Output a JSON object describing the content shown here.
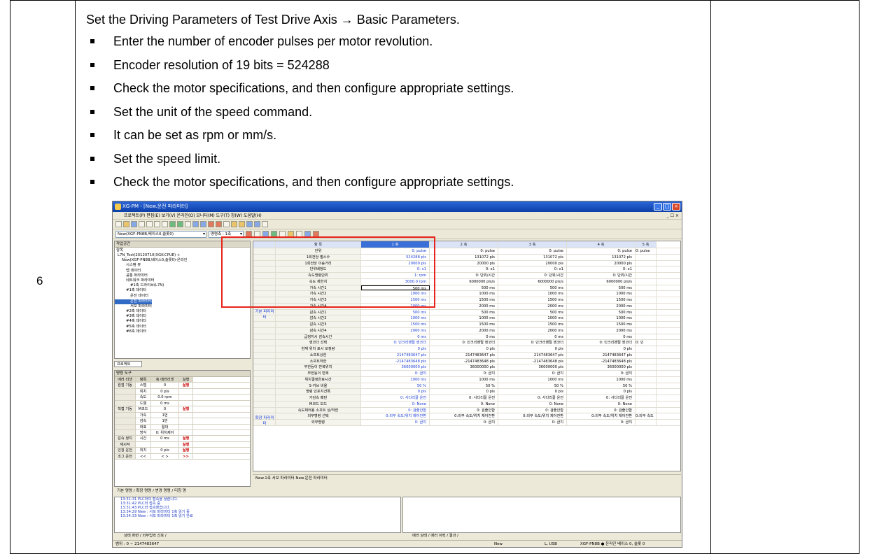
{
  "step": {
    "number": "6"
  },
  "instructions": {
    "intro": "Set the Driving Parameters of Test Drive Axis → Basic Parameters.",
    "bullets": [
      "Enter the number of encoder pulses per motor revolution.",
      "Encoder resolution of 19 bits = 524288",
      "Check the motor specifications, and then configure appropriate settings.",
      "Set the unit of the speed command.",
      "It can be set as rpm or mm/s.",
      "Set the speed limit.",
      "Check the motor specifications, and then configure appropriate settings."
    ]
  },
  "app": {
    "title": "XG-PM - [New.운전 파라미터]",
    "menu": "프로젝트(P)  편집(E)  보기(V)  온라인(O)  모니터(M)  도구(T)  창(W)  도움말(H)",
    "menu_right": "_ ☐ ×",
    "device_combo": "New(XGF-PN8B,베이스0,슬롯0)",
    "axis_combo": "명령축 : 1축",
    "workspace": {
      "title": "작업공간",
      "header": "항목",
      "tree": [
        "L7N_Test(20120710(XGK-CPUE) +",
        "New(XGF-PN8B,베이스0,슬롯0)-온라인",
        "시스템 뷰",
        "맵 데이터",
        "공통 파라미터",
        "네트워크 파라미터",
        "#1축 드라이브(L7N)",
        "#1축 데이터",
        "운전 데이터",
        "운전 파라미터",
        "서보 파라미터",
        "#2축 데이터",
        "#3축 데이터",
        "#4축 데이터",
        "#5축 데이터",
        "#6축 데이터"
      ],
      "selected_index": 9,
      "project_tab": "프로젝트"
    },
    "monitor": {
      "title": "명령 도구",
      "header": [
        "에러 리셋",
        "항목",
        "축 에러리셋",
        "실행"
      ],
      "rows": [
        [
          "원점 기동",
          "스텝",
          "0",
          "실행"
        ],
        [
          "",
          "위치",
          "0 pls",
          ""
        ],
        [
          "",
          "속도",
          "0.0 rpm",
          ""
        ],
        [
          "",
          "드웰",
          "0 ms",
          ""
        ],
        [
          "직접 기동",
          "M코드",
          "0",
          "실행"
        ],
        [
          "",
          "가속",
          "1번",
          ""
        ],
        [
          "",
          "감속",
          "1번",
          ""
        ],
        [
          "",
          "좌표",
          "절대",
          ""
        ],
        [
          "",
          "방식",
          "0: 위치제어",
          ""
        ],
        [
          "감속 정지",
          "시간",
          "0 ms",
          "실행"
        ],
        [
          "재시작",
          "",
          "",
          "실행"
        ],
        [
          "인칭 운전",
          "위치",
          "0 pls",
          "실행"
        ],
        [
          "조그 운전",
          "<<",
          "<  >",
          ">>"
        ]
      ],
      "tabs": "기본 명령 / 확장 명령 / 변경 명령 / 티칭 명"
    },
    "grid": {
      "header": [
        "항 목",
        "1 축",
        "2 축",
        "3 축",
        "4 축",
        "5 축"
      ],
      "group_basic": "기본 파라미터",
      "group_ext": "확장 파라미터",
      "rows": [
        [
          "단위",
          "0: pulse",
          "0: pulse",
          "0: pulse",
          "0: pulse"
        ],
        [
          "1회전당 펄스수",
          "524288 pls",
          "131072 pls",
          "131072 pls",
          "131072 pls"
        ],
        [
          "1회전당 이송거리",
          "20000 pls",
          "20000 pls",
          "20000 pls",
          "20000 pls"
        ],
        [
          "단위배정도",
          "0: x1",
          "0: x1",
          "0: x1",
          "0: x1"
        ],
        [
          "속도명령단위",
          "1: rpm",
          "0: 단위/시간",
          "0: 단위/시간",
          "0: 단위/시간"
        ],
        [
          "속도 제한치",
          "3000.0 rpm",
          "6000000 pls/s",
          "6000000 pls/s",
          "6000000 pls/s"
        ],
        [
          "가속 시간1",
          "500 ms",
          "500 ms",
          "500 ms",
          "500 ms"
        ],
        [
          "가속 시간2",
          "1000 ms",
          "1000 ms",
          "1000 ms",
          "1000 ms"
        ],
        [
          "가속 시간3",
          "1500 ms",
          "1500 ms",
          "1500 ms",
          "1500 ms"
        ],
        [
          "가속 시간4",
          "2000 ms",
          "2000 ms",
          "2000 ms",
          "2000 ms"
        ],
        [
          "감속 시간1",
          "500 ms",
          "500 ms",
          "500 ms",
          "500 ms"
        ],
        [
          "감속 시간2",
          "1000 ms",
          "1000 ms",
          "1000 ms",
          "1000 ms"
        ],
        [
          "감속 시간3",
          "1500 ms",
          "1500 ms",
          "1500 ms",
          "1500 ms"
        ],
        [
          "감속 시간4",
          "2000 ms",
          "2000 ms",
          "2000 ms",
          "2000 ms"
        ],
        [
          "급정지시 감속시간",
          "0 ms",
          "0 ms",
          "0 ms",
          "0 ms"
        ],
        [
          "엔코더 선택",
          "0: 인크리멘탈 엔코더",
          "0: 인크리멘탈 엔코더",
          "0: 인크리멘탈 엔코더",
          "0: 인크리멘탈 엔코더"
        ],
        [
          "현재 위치 표시 보정량",
          "0 pls",
          "0 pls",
          "0 pls",
          "0 pls"
        ],
        [
          "소프트상한",
          "2147483647 pls",
          "2147483647 pls",
          "2147483647 pls",
          "2147483647 pls"
        ],
        [
          "소프트하한",
          "-2147483648 pls",
          "-2147483648 pls",
          "-2147483648 pls",
          "-2147483648 pls"
        ],
        [
          "무한등이 반복위치",
          "36000000 pls",
          "36000000 pls",
          "36000000 pls",
          "36000000 pls"
        ],
        [
          "무한등이 반복",
          "0: 금지",
          "0: 금지",
          "0: 금지",
          "0: 금지"
        ],
        [
          "위치결정완료시간",
          "1000 ms",
          "1000 ms",
          "1000 ms",
          "1000 ms"
        ],
        [
          "S-커브 비율",
          "50 %",
          "50 %",
          "50 %",
          "50 %"
        ],
        [
          "명령 인포지션폭",
          "0 pls",
          "0 pls",
          "0 pls",
          "0 pls"
        ],
        [
          "가감속 패턴",
          "0: 사다리꼴 운전",
          "0: 사다리꼴 운전",
          "0: 사다리꼴 운전",
          "0: 사다리꼴 운전"
        ],
        [
          "M코드 모드",
          "0: None",
          "0: None",
          "0: None",
          "0: None"
        ],
        [
          "속도제어용 소프트 상/하한",
          "0: 검출안함",
          "0: 검출안함",
          "0: 검출안함",
          "0: 검출안함"
        ],
        [
          "외부명령 선택",
          "0:외부 속도/위치 제어전환",
          "0:외부 속도/위치 제어전환",
          "0:외부 속도/위치 제어전환",
          "0:외부 속도/위치 제어전환"
        ],
        [
          "외부명령",
          "0: 금지",
          "0: 금지",
          "0: 금지",
          "0: 금지"
        ]
      ],
      "col5_tail": [
        "0: pulse",
        "",
        "",
        "",
        "",
        "",
        "",
        "",
        "",
        "",
        "",
        "",
        "",
        "",
        "",
        "0: 인",
        "",
        "",
        "",
        "",
        "",
        "",
        "",
        "",
        "",
        "",
        "",
        "0:외부 속도",
        ""
      ],
      "tabs": "New.1축 서보 파라미터   New.운전 파라미터"
    },
    "log": {
      "lines": [
        "13:31:31 PLC와의 접속을 끊습니다.",
        "13:31:42 PLC와 접속 중",
        "13:31:43 PLC와 접속했습니다.",
        "13:34:29 New : 서보 파라미터 1축 읽기 중",
        "13:34:33 New : 서보 파라미터 1축 읽기 완료"
      ],
      "tabs_left": "상태 화면 / 외부입력 신호 /",
      "tabs_right": "에러 상태 / 에러 이력 / 결과 /"
    },
    "status": {
      "left": "범위 : 0 ~ 2147483647",
      "new": "New",
      "port": "L, USB",
      "conn": "XGF-PN8B  ● 온라인   베이스 0, 슬롯 0"
    }
  }
}
